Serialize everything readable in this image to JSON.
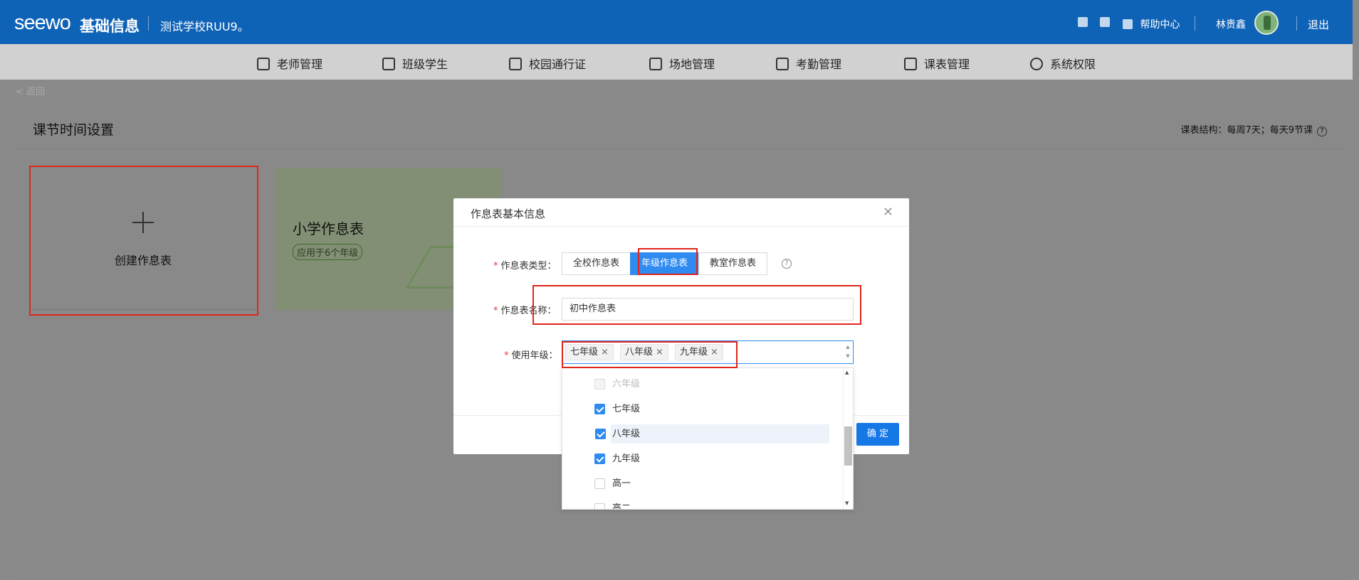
{
  "header": {
    "logo": "seewo",
    "app_name": "基础信息",
    "school": "测试学校RUU9。",
    "help_label": "帮助中心",
    "user_name": "林贵鑫",
    "logout_label": "退出"
  },
  "nav": {
    "items": [
      {
        "label": "老师管理",
        "icon": "user-icon"
      },
      {
        "label": "班级学生",
        "icon": "graduation-cap-icon"
      },
      {
        "label": "校园通行证",
        "icon": "id-card-icon"
      },
      {
        "label": "场地管理",
        "icon": "building-icon"
      },
      {
        "label": "考勤管理",
        "icon": "clipboard-check-icon"
      },
      {
        "label": "课表管理",
        "icon": "calendar-icon"
      },
      {
        "label": "系统权限",
        "icon": "shield-icon"
      }
    ]
  },
  "breadcrumb": "< 返回",
  "panel": {
    "title": "课节时间设置",
    "structure": "课表结构：每周7天；每天9节课"
  },
  "cards": {
    "create_label": "创建作息表",
    "primary_title": "小学作息表",
    "primary_tag": "应用于6个年级"
  },
  "modal": {
    "title": "作息表基本信息",
    "type_label": "作息表类型：",
    "type_options": [
      "全校作息表",
      "年级作息表",
      "教室作息表"
    ],
    "type_selected": "年级作息表",
    "name_label": "作息表名称：",
    "name_value": "初中作息表",
    "grade_label": "使用年级：",
    "selected_grades": [
      "七年级",
      "八年级",
      "九年级"
    ],
    "ok_label": "确 定"
  },
  "dropdown": {
    "options": [
      {
        "label": "六年级",
        "state": "disabled"
      },
      {
        "label": "七年级",
        "state": "checked"
      },
      {
        "label": "八年级",
        "state": "checked"
      },
      {
        "label": "九年级",
        "state": "checked"
      },
      {
        "label": "高一",
        "state": "unchecked"
      },
      {
        "label": "高二",
        "state": "unchecked"
      }
    ]
  },
  "colors": {
    "header_bg": "#0f63b7",
    "accent": "#2f8bf0",
    "annotation_red": "#e0261b"
  }
}
